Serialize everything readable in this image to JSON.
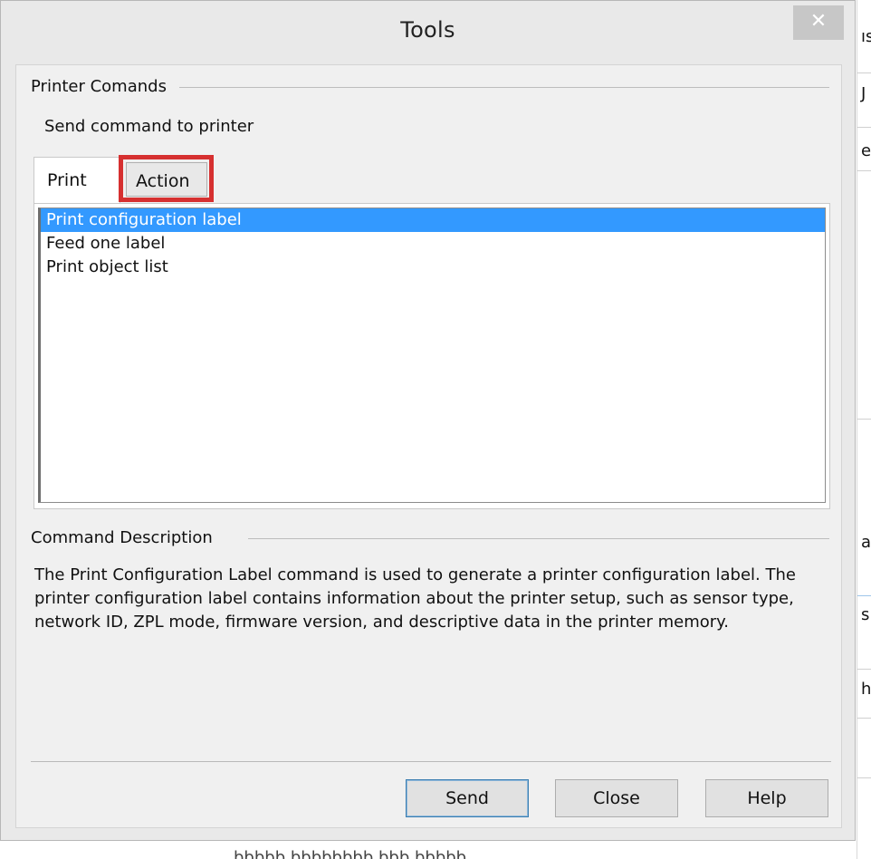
{
  "window": {
    "title": "Tools",
    "close_glyph": "✕"
  },
  "printer_group": {
    "label": "Printer Comands",
    "subtitle": "Send command to printer"
  },
  "tabs": [
    {
      "label": "Print",
      "active": true
    },
    {
      "label": "Action",
      "active": false
    }
  ],
  "command_list": {
    "items": [
      {
        "label": "Print configuration label",
        "selected": true
      },
      {
        "label": "Feed one label",
        "selected": false
      },
      {
        "label": "Print object list",
        "selected": false
      }
    ]
  },
  "description_group": {
    "label": "Command Description",
    "text": "The Print Configuration Label command is used to generate a printer configuration label. The printer configuration label contains information about the printer setup, such as sensor type, network ID, ZPL mode, firmware version, and descriptive data in the printer memory."
  },
  "buttons": {
    "send": "Send",
    "close": "Close",
    "help": "Help"
  },
  "background": {
    "right_chars": [
      "ıs",
      "J",
      "e",
      "a",
      "s",
      "h"
    ],
    "bottom_text": "bbbbb bbbbbbbb bbb bbbbb"
  },
  "colors": {
    "selection": "#3399ff",
    "highlight_box": "#d63030",
    "default_button_border": "#3c7fb1"
  }
}
